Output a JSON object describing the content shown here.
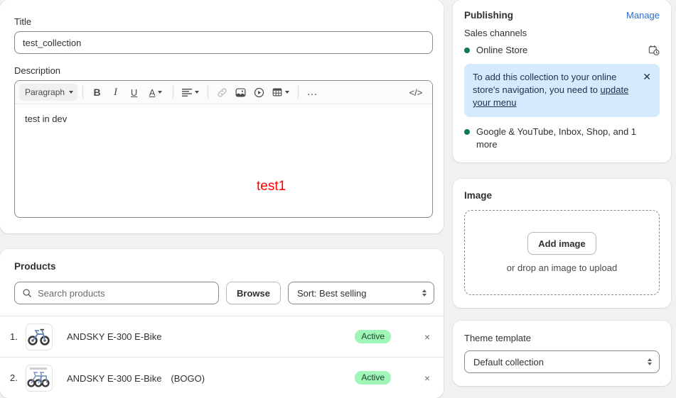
{
  "details": {
    "title_label": "Title",
    "title_value": "test_collection",
    "description_label": "Description",
    "toolbar": {
      "block_format": "Paragraph",
      "bold": "B",
      "italic": "I",
      "underline": "U",
      "text_color": "A",
      "align": "align-left-icon",
      "link": "link-icon",
      "image": "image-icon",
      "video": "video-icon",
      "table": "table-icon",
      "more": "…",
      "code": "</>"
    },
    "body_line_1": "test in dev",
    "body_line_2": "test1",
    "body_line_2_color": "#ff0000"
  },
  "products": {
    "section_title": "Products",
    "search_placeholder": "Search products",
    "browse_label": "Browse",
    "sort_value": "Sort: Best selling",
    "items": [
      {
        "index": "1.",
        "name": "ANDSKY E-300 E-Bike",
        "status": "Active"
      },
      {
        "index": "2.",
        "name": "ANDSKY E-300 E-Bike　(BOGO)",
        "status": "Active"
      }
    ],
    "remove_label": "×"
  },
  "publishing": {
    "title": "Publishing",
    "manage_label": "Manage",
    "sales_channels_label": "Sales channels",
    "channels": [
      {
        "name": "Online Store",
        "icon": "calendar-clock-icon"
      },
      {
        "name": "Google & YouTube, Inbox, Shop, and 1 more",
        "icon": ""
      }
    ],
    "banner": {
      "text": "To add this collection to your online store's navigation, you need to ",
      "link_text": "update your menu",
      "close_label": "✕",
      "background": "#d5eafc"
    },
    "dot_color": "#0c7b55"
  },
  "image": {
    "title": "Image",
    "add_label": "Add image",
    "hint": "or drop an image to upload"
  },
  "theme": {
    "label": "Theme template",
    "value": "Default collection"
  }
}
